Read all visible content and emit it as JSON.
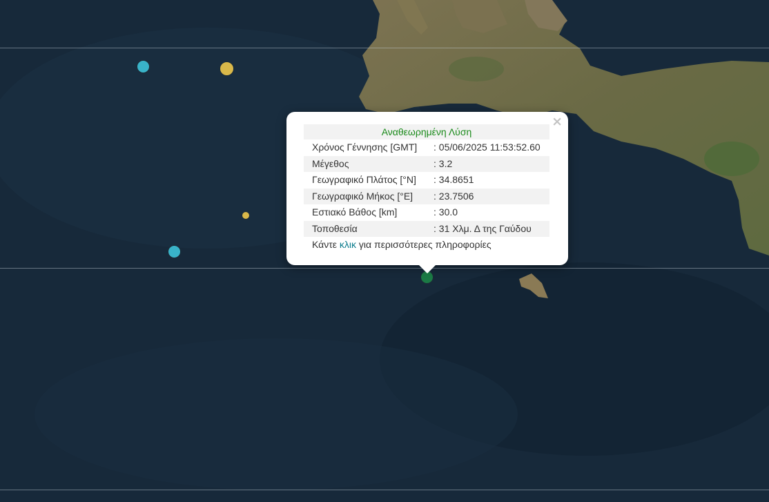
{
  "map": {
    "sea_color": "#17293a",
    "land_color": "#6e6a4c"
  },
  "markers": [
    {
      "color": "#39b3c9",
      "label": "cyan-marker"
    },
    {
      "color": "#d9b84a",
      "label": "yellow-marker"
    },
    {
      "color": "#d9b84a",
      "label": "small-yellow-marker"
    },
    {
      "color": "#39b3c9",
      "label": "cyan-marker"
    },
    {
      "color": "#1b7a45",
      "label": "selected-marker"
    }
  ],
  "popup": {
    "close_symbol": "×",
    "title": "Αναθεωρημένη Λύση",
    "rows": [
      {
        "label": "Χρόνος Γέννησης [GMT]",
        "value": ": 05/06/2025 11:53:52.60"
      },
      {
        "label": "Μέγεθος",
        "value": ": 3.2"
      },
      {
        "label": "Γεωγραφικό Πλάτος [°N]",
        "value": ": 34.8651"
      },
      {
        "label": "Γεωγραφικό Μήκος [°E]",
        "value": ": 23.7506"
      },
      {
        "label": "Εστιακό Βάθος [km]",
        "value": ": 30.0"
      },
      {
        "label": "Τοποθεσία",
        "value": ": 31 Χλμ. Δ της Γαύδου"
      }
    ],
    "footer_prefix": "Κάντε ",
    "footer_link": "κλικ",
    "footer_suffix": " για περισσότερες πληροφορίες"
  }
}
